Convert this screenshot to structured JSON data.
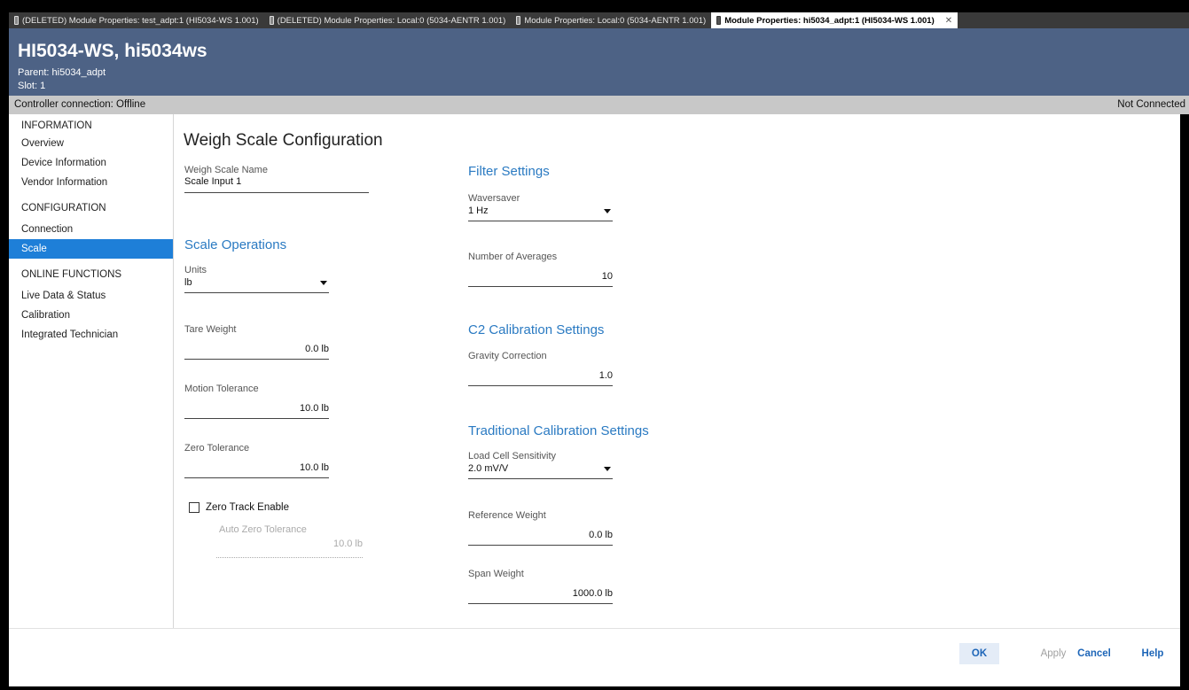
{
  "tabs": [
    {
      "label": "(DELETED) Module Properties: test_adpt:1 (HI5034-WS 1.001)",
      "active": false
    },
    {
      "label": "(DELETED) Module Properties: Local:0 (5034-AENTR 1.001)",
      "active": false
    },
    {
      "label": "Module Properties: Local:0 (5034-AENTR 1.001)",
      "active": false
    },
    {
      "label": "Module Properties: hi5034_adpt:1 (HI5034-WS 1.001)",
      "active": true
    }
  ],
  "header": {
    "title": "HI5034-WS, hi5034ws",
    "parent": "Parent: hi5034_adpt",
    "slot": "Slot: 1"
  },
  "status": {
    "connection": "Controller connection: Offline",
    "state": "Not Connected"
  },
  "sidebar": {
    "sections": [
      {
        "title": "INFORMATION",
        "items": [
          "Overview",
          "Device Information",
          "Vendor Information"
        ]
      },
      {
        "title": "CONFIGURATION",
        "items": [
          "Connection",
          "Scale"
        ]
      },
      {
        "title": "ONLINE FUNCTIONS",
        "items": [
          "Live Data & Status",
          "Calibration",
          "Integrated Technician"
        ]
      }
    ],
    "selected": "Scale"
  },
  "content": {
    "page_title": "Weigh Scale Configuration",
    "weigh_scale_name": {
      "label": "Weigh Scale Name",
      "value": "Scale Input 1"
    },
    "scale_operations": {
      "title": "Scale Operations",
      "units": {
        "label": "Units",
        "value": "lb"
      },
      "tare_weight": {
        "label": "Tare Weight",
        "value": "0.0 lb"
      },
      "motion_tolerance": {
        "label": "Motion Tolerance",
        "value": "10.0 lb"
      },
      "zero_tolerance": {
        "label": "Zero Tolerance",
        "value": "10.0 lb"
      },
      "zero_track_enable": {
        "label": "Zero Track Enable",
        "checked": false
      },
      "auto_zero_tolerance": {
        "label": "Auto Zero Tolerance",
        "value": "10.0 lb"
      }
    },
    "filter_settings": {
      "title": "Filter Settings",
      "waversaver": {
        "label": "Waversaver",
        "value": "1 Hz"
      },
      "number_of_averages": {
        "label": "Number of Averages",
        "value": "10"
      }
    },
    "c2_calibration": {
      "title": "C2 Calibration Settings",
      "gravity_correction": {
        "label": "Gravity Correction",
        "value": "1.0"
      }
    },
    "traditional_calibration": {
      "title": "Traditional Calibration Settings",
      "load_cell_sensitivity": {
        "label": "Load Cell Sensitivity",
        "value": "2.0 mV/V"
      },
      "reference_weight": {
        "label": "Reference Weight",
        "value": "0.0 lb"
      },
      "span_weight": {
        "label": "Span Weight",
        "value": "1000.0 lb"
      }
    }
  },
  "footer": {
    "ok": "OK",
    "apply": "Apply",
    "cancel": "Cancel",
    "help": "Help"
  },
  "colors": {
    "header_bg": "#4d6285",
    "accent": "#1e7fd8",
    "section_title": "#2a7ac2",
    "status_bar": "#c8c8c8"
  }
}
